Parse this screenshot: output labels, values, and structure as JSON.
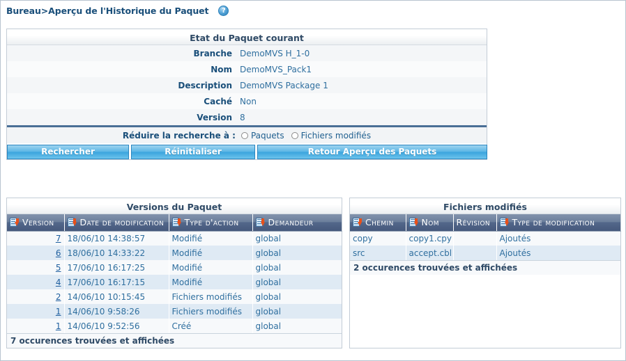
{
  "breadcrumb": {
    "text": "Bureau>Aperçu de l'Historique du Paquet",
    "help_icon_label": "?"
  },
  "status_panel": {
    "caption": "Etat du Paquet courant",
    "rows": [
      {
        "label": "Branche",
        "value": "DemoMVS H_1-0"
      },
      {
        "label": "Nom",
        "value": "DemoMVS_Pack1"
      },
      {
        "label": "Description",
        "value": "DemoMVS Package 1"
      },
      {
        "label": "Caché",
        "value": "Non"
      },
      {
        "label": "Version",
        "value": "8"
      }
    ],
    "narrow_label": "Réduire la recherche à :",
    "radios": [
      {
        "label": "Paquets",
        "checked": false
      },
      {
        "label": "Fichiers modifiés",
        "checked": false
      }
    ],
    "buttons": {
      "search": "Rechercher",
      "reset": "Réinitialiser",
      "back": "Retour Aperçu des Paquets"
    }
  },
  "versions_panel": {
    "caption": "Versions du Paquet",
    "columns": [
      {
        "label": "Version",
        "sortable": true
      },
      {
        "label": "Date de modification",
        "sortable": true
      },
      {
        "label": "Type d'action",
        "sortable": true
      },
      {
        "label": "Demandeur",
        "sortable": true
      }
    ],
    "rows": [
      {
        "version": "7",
        "date": "18/06/10 14:38:57",
        "action": "Modifié",
        "requester": "global"
      },
      {
        "version": "6",
        "date": "18/06/10 14:33:22",
        "action": "Modifié",
        "requester": "global"
      },
      {
        "version": "5",
        "date": "17/06/10 16:17:25",
        "action": "Modifié",
        "requester": "global"
      },
      {
        "version": "4",
        "date": "17/06/10 16:17:15",
        "action": "Modifié",
        "requester": "global"
      },
      {
        "version": "2",
        "date": "14/06/10 10:15:45",
        "action": "Fichiers modifiés",
        "requester": "global"
      },
      {
        "version": "1",
        "date": "14/06/10 9:58:26",
        "action": "Fichiers modifiés",
        "requester": "global"
      },
      {
        "version": "1",
        "date": "14/06/10 9:52:56",
        "action": "Créé",
        "requester": "global"
      }
    ],
    "footer": "7 occurences trouvées et affichées"
  },
  "files_panel": {
    "caption": "Fichiers modifiés",
    "columns": [
      {
        "label": "Chemin",
        "sortable": true
      },
      {
        "label": "Nom",
        "sortable": true
      },
      {
        "label": "Révision",
        "sortable": false
      },
      {
        "label": "Type de modification",
        "sortable": true
      }
    ],
    "rows": [
      {
        "path": "copy",
        "name": "copy1.cpy",
        "revision": "",
        "modtype": "Ajoutés"
      },
      {
        "path": "src",
        "name": "accept.cbl",
        "revision": "",
        "modtype": "Ajoutés"
      }
    ],
    "footer": "2 occurences trouvées et affichées"
  },
  "colors": {
    "link_blue": "#1f5f9f",
    "label_blue": "#1a4f7a",
    "value_blue": "#2f6f9f",
    "green": "#1a8a3a",
    "header_grad_top": "#8293ad",
    "header_grad_bottom": "#46597c",
    "button_blue": "#39a4dd",
    "row_alt": "#dfeaf4"
  }
}
